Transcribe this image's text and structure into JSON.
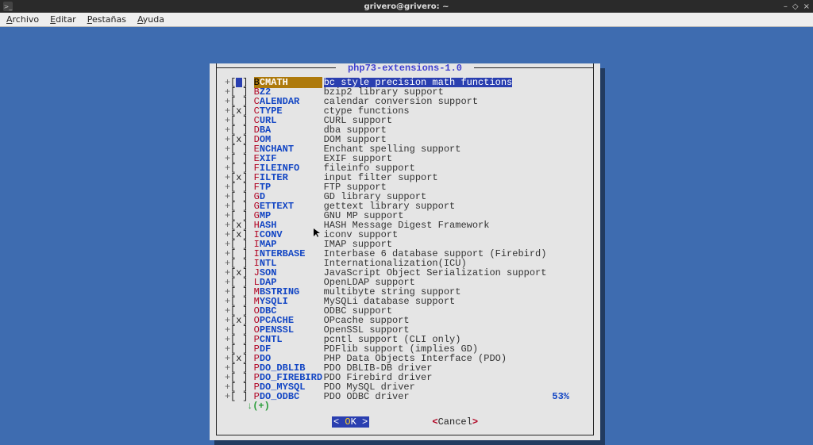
{
  "window": {
    "title": "grivero@grivero: ~",
    "controls": {
      "min": "–",
      "max": "◇",
      "close": "×"
    }
  },
  "menubar": {
    "items": [
      {
        "u": "A",
        "rest": "rchivo"
      },
      {
        "u": "E",
        "rest": "ditar"
      },
      {
        "u": "P",
        "rest": "estañas"
      },
      {
        "u": "A",
        "rest": "yuda"
      }
    ]
  },
  "dialog": {
    "title": "php73-extensions-1.0",
    "percent": "53%",
    "more": "↓(+)",
    "ok_before": "<",
    "ok_hot": " O",
    "ok_after": "K ",
    "ok_close": ">",
    "cancel": "Cancel"
  },
  "items": [
    {
      "mark": " ",
      "name": "BCMATH",
      "desc": "bc style precision math functions",
      "selected": true
    },
    {
      "mark": " ",
      "name": "BZ2",
      "desc": "bzip2 library support"
    },
    {
      "mark": " ",
      "name": "CALENDAR",
      "desc": "calendar conversion support"
    },
    {
      "mark": "x",
      "name": "CTYPE",
      "desc": "ctype functions"
    },
    {
      "mark": " ",
      "name": "CURL",
      "desc": "CURL support"
    },
    {
      "mark": " ",
      "name": "DBA",
      "desc": "dba support"
    },
    {
      "mark": "x",
      "name": "DOM",
      "desc": "DOM support"
    },
    {
      "mark": " ",
      "name": "ENCHANT",
      "desc": "Enchant spelling support"
    },
    {
      "mark": " ",
      "name": "EXIF",
      "desc": "EXIF support"
    },
    {
      "mark": " ",
      "name": "FILEINFO",
      "desc": "fileinfo support"
    },
    {
      "mark": "x",
      "name": "FILTER",
      "desc": "input filter support"
    },
    {
      "mark": " ",
      "name": "FTP",
      "desc": "FTP support"
    },
    {
      "mark": " ",
      "name": "GD",
      "desc": "GD library support"
    },
    {
      "mark": " ",
      "name": "GETTEXT",
      "desc": "gettext library support"
    },
    {
      "mark": " ",
      "name": "GMP",
      "desc": "GNU MP support"
    },
    {
      "mark": "x",
      "name": "HASH",
      "desc": "HASH Message Digest Framework"
    },
    {
      "mark": "x",
      "name": "ICONV",
      "desc": "iconv support"
    },
    {
      "mark": " ",
      "name": "IMAP",
      "desc": "IMAP support"
    },
    {
      "mark": " ",
      "name": "INTERBASE",
      "desc": "Interbase 6 database support (Firebird)"
    },
    {
      "mark": " ",
      "name": "INTL",
      "desc": "Internationalization(ICU)"
    },
    {
      "mark": "x",
      "name": "JSON",
      "desc": "JavaScript Object Serialization support"
    },
    {
      "mark": " ",
      "name": "LDAP",
      "desc": "OpenLDAP support"
    },
    {
      "mark": " ",
      "name": "MBSTRING",
      "desc": "multibyte string support"
    },
    {
      "mark": " ",
      "name": "MYSQLI",
      "desc": "MySQLi database support"
    },
    {
      "mark": " ",
      "name": "ODBC",
      "desc": "ODBC support"
    },
    {
      "mark": "x",
      "name": "OPCACHE",
      "desc": "OPcache support"
    },
    {
      "mark": " ",
      "name": "OPENSSL",
      "desc": "OpenSSL support"
    },
    {
      "mark": " ",
      "name": "PCNTL",
      "desc": "pcntl support (CLI only)"
    },
    {
      "mark": " ",
      "name": "PDF",
      "desc": "PDFlib support (implies GD)"
    },
    {
      "mark": "x",
      "name": "PDO",
      "desc": "PHP Data Objects Interface (PDO)"
    },
    {
      "mark": " ",
      "name": "PDO_DBLIB",
      "desc": "PDO DBLIB-DB driver"
    },
    {
      "mark": " ",
      "name": "PDO_FIREBIRD",
      "desc": "PDO Firebird driver"
    },
    {
      "mark": " ",
      "name": "PDO_MYSQL",
      "desc": "PDO MySQL driver"
    },
    {
      "mark": " ",
      "name": "PDO_ODBC",
      "desc": "PDO ODBC driver"
    }
  ]
}
